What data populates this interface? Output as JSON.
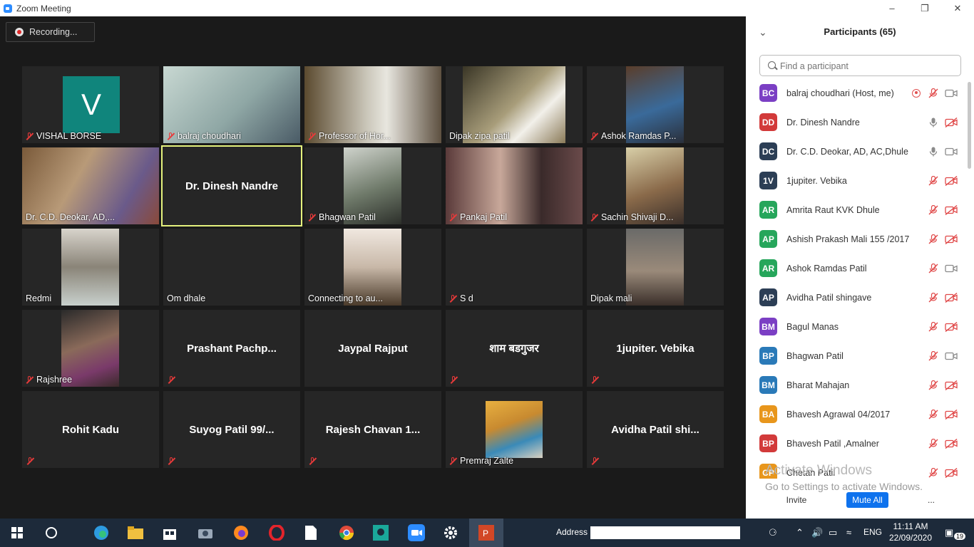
{
  "window": {
    "title": "Zoom Meeting"
  },
  "gallery": {
    "recording_label": "Recording...",
    "tiles": [
      {
        "name": "VISHAL BORSE",
        "avatar_letter": "V"
      },
      {
        "name": "balraj choudhari"
      },
      {
        "name": "Professor of Hor..."
      },
      {
        "name": "Dipak zipa patil"
      },
      {
        "name": "Ashok Ramdas P..."
      },
      {
        "name": "Dr. C.D. Deokar, AD,..."
      },
      {
        "name": "Dr. Dinesh Nandre"
      },
      {
        "name": "Bhagwan Patil"
      },
      {
        "name": "Pankaj Patil"
      },
      {
        "name": "Sachin  Shivaji D..."
      },
      {
        "name": "Redmi"
      },
      {
        "name": "Om dhale"
      },
      {
        "name": "Connecting to au..."
      },
      {
        "name": "S d"
      },
      {
        "name": "Dipak mali"
      },
      {
        "name": "Rajshree"
      },
      {
        "name": "Prashant  Pachp..."
      },
      {
        "name": "Jaypal Rajput"
      },
      {
        "name": "शाम बडगुजर"
      },
      {
        "name": "1jupiter. Vebika"
      },
      {
        "name": "Rohit Kadu"
      },
      {
        "name": "Suyog Patil 99/..."
      },
      {
        "name": "Rajesh Chavan 1..."
      },
      {
        "name": "Premraj Zalte"
      },
      {
        "name": "Avidha Patil shi..."
      }
    ]
  },
  "panel": {
    "title": "Participants (65)",
    "search_placeholder": "Find a participant",
    "participants": [
      {
        "initials": "BC",
        "name": "balraj choudhari (Host, me)",
        "color": "#7b3fc4",
        "mic": "muted",
        "video": "on",
        "recording": true
      },
      {
        "initials": "DD",
        "name": "Dr. Dinesh Nandre",
        "color": "#d23a3a",
        "mic": "on",
        "video": "off"
      },
      {
        "initials": "DC",
        "name": "Dr. C.D. Deokar, AD, AC,Dhule",
        "color": "#2c3e55",
        "mic": "on",
        "video": "on"
      },
      {
        "initials": "1V",
        "name": "1jupiter. Vebika",
        "color": "#2c3e55",
        "mic": "muted",
        "video": "off"
      },
      {
        "initials": "AR",
        "name": "Amrita Raut KVK Dhule",
        "color": "#26a65b",
        "mic": "muted",
        "video": "off"
      },
      {
        "initials": "AP",
        "name": "Ashish Prakash Mali 155 /2017",
        "color": "#26a65b",
        "mic": "muted",
        "video": "off"
      },
      {
        "initials": "AR",
        "name": "Ashok Ramdas Patil",
        "color": "#26a65b",
        "mic": "muted",
        "video": "on"
      },
      {
        "initials": "AP",
        "name": "Avidha Patil shingave",
        "color": "#2c3e55",
        "mic": "muted",
        "video": "off"
      },
      {
        "initials": "BM",
        "name": "Bagul Manas",
        "color": "#7b3fc4",
        "mic": "muted",
        "video": "off"
      },
      {
        "initials": "BP",
        "name": "Bhagwan Patil",
        "color": "#2a7ab8",
        "mic": "muted",
        "video": "on"
      },
      {
        "initials": "BM",
        "name": "Bharat Mahajan",
        "color": "#2a7ab8",
        "mic": "muted",
        "video": "off"
      },
      {
        "initials": "BA",
        "name": "Bhavesh Agrawal 04/2017",
        "color": "#e8961c",
        "mic": "muted",
        "video": "off"
      },
      {
        "initials": "BP",
        "name": "Bhavesh Patil ,Amalner",
        "color": "#d23a3a",
        "mic": "muted",
        "video": "off"
      },
      {
        "initials": "CP",
        "name": "Chetan Patil",
        "color": "#e8961c",
        "mic": "muted",
        "video": "off"
      }
    ],
    "watermark_line1": "Activate Windows",
    "watermark_line2": "Go to Settings to activate Windows.",
    "invite_label": "Invite",
    "mute_all_label": "Mute All",
    "more_label": "..."
  },
  "taskbar": {
    "address_label": "Address",
    "language": "ENG",
    "time": "11:11 AM",
    "date": "22/09/2020",
    "notification_count": "19"
  }
}
